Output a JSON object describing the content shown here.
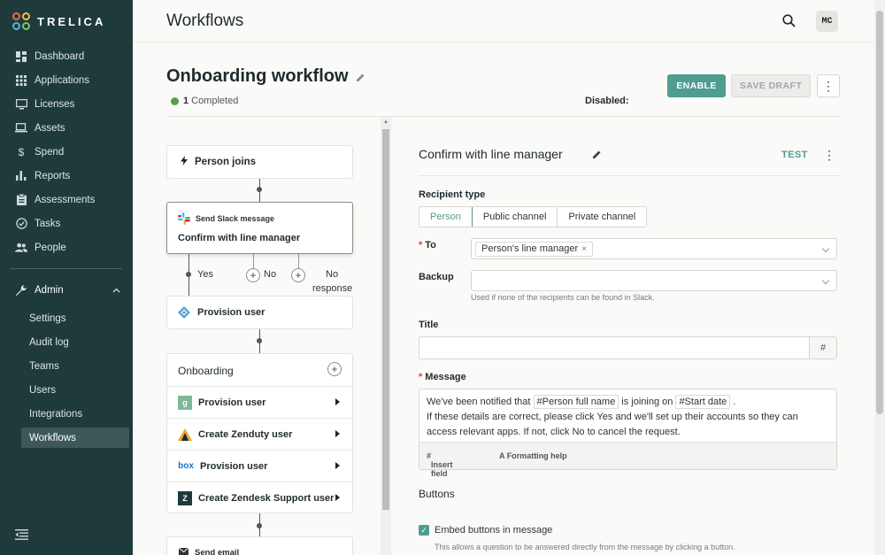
{
  "app": {
    "brand": "TRELICA",
    "colors": {
      "sidebar": "#1f3a3a",
      "accent": "#4f9c91",
      "status_ok": "#5a9e4b",
      "required": "#d0463a"
    }
  },
  "sidebar": {
    "items": [
      {
        "label": "Dashboard",
        "icon": "dashboard-icon"
      },
      {
        "label": "Applications",
        "icon": "grid-icon"
      },
      {
        "label": "Licenses",
        "icon": "monitor-icon"
      },
      {
        "label": "Assets",
        "icon": "laptop-icon"
      },
      {
        "label": "Spend",
        "icon": "dollar-icon"
      },
      {
        "label": "Reports",
        "icon": "bar-chart-icon"
      },
      {
        "label": "Assessments",
        "icon": "clipboard-icon"
      },
      {
        "label": "Tasks",
        "icon": "check-circle-icon"
      },
      {
        "label": "People",
        "icon": "people-icon"
      }
    ],
    "admin": {
      "label": "Admin",
      "items": [
        "Settings",
        "Audit log",
        "Teams",
        "Users",
        "Integrations",
        "Workflows"
      ],
      "active": "Workflows"
    }
  },
  "header": {
    "title": "Workflows",
    "avatar": "MC"
  },
  "workflow": {
    "title": "Onboarding workflow",
    "status_label": "Disabled:",
    "completed": "1",
    "completed_label": "Completed",
    "enable_label": "ENABLE",
    "draft_label": "SAVE DRAFT"
  },
  "canvas": {
    "trigger": "Person joins",
    "slack_sub": "Send Slack message",
    "slack_name": "Confirm with line manager",
    "branches": {
      "yes": "Yes",
      "no": "No",
      "no_response_1": "No",
      "no_response_2": "response"
    },
    "provision": "Provision user",
    "group": {
      "title": "Onboarding",
      "rows": [
        "Provision user",
        "Create Zenduty user",
        "Provision user",
        "Create Zendesk Support user"
      ]
    },
    "email": "Send email"
  },
  "panel": {
    "title": "Confirm with line manager",
    "test_label": "TEST",
    "recipient_type_label": "Recipient type",
    "recipient_types": [
      "Person",
      "Public channel",
      "Private channel"
    ],
    "to_label": "To",
    "to_chip": "Person's line manager",
    "backup_label": "Backup",
    "backup_hint": "Used if none of the recipients can be found in Slack.",
    "title_label": "Title",
    "message_label": "Message",
    "message": {
      "p1": "We've been notified that",
      "tag1": "#Person full name",
      "p2": "is joining on",
      "tag2": "#Start date",
      "p3": ".",
      "line2": "If these details are correct, please click Yes and we'll set up their accounts so they can access relevant apps. If not, click No to cancel the request."
    },
    "insert_field": "Insert field",
    "formatting_help": "Formatting help",
    "buttons_heading": "Buttons",
    "embed_label": "Embed buttons in message",
    "embed_hint": "This allows a question to be answered directly from the message by clicking a button."
  }
}
